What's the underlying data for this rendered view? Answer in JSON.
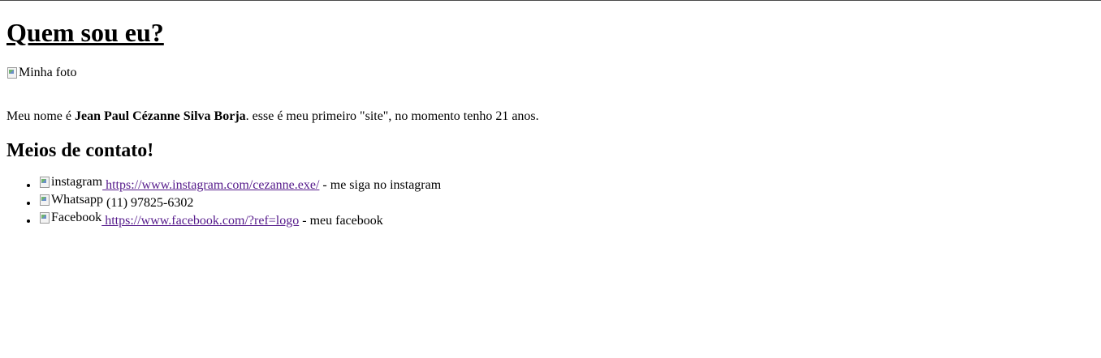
{
  "heading": "Quem sou eu?",
  "photo_alt": "Minha foto",
  "bio": {
    "prefix": "Meu nome é ",
    "name": "Jean Paul Cézanne Silva Borja",
    "suffix": ". esse é meu primeiro \"site\", no momento tenho 21 anos."
  },
  "contact_heading": "Meios de contato!",
  "contacts": [
    {
      "icon_alt": "instagram",
      "link": " https://www.instagram.com/cezanne.exe/",
      "text": " - me siga no instagram"
    },
    {
      "icon_alt": "Whatsapp",
      "link": "",
      "text": " (11) 97825-6302"
    },
    {
      "icon_alt": "Facebook",
      "link": " https://www.facebook.com/?ref=logo",
      "text": " - meu facebook"
    }
  ],
  "colors": {
    "visited_link": "#551a8b",
    "text": "#000000",
    "background": "#ffffff"
  },
  "icons": [
    "broken-image-icon"
  ]
}
